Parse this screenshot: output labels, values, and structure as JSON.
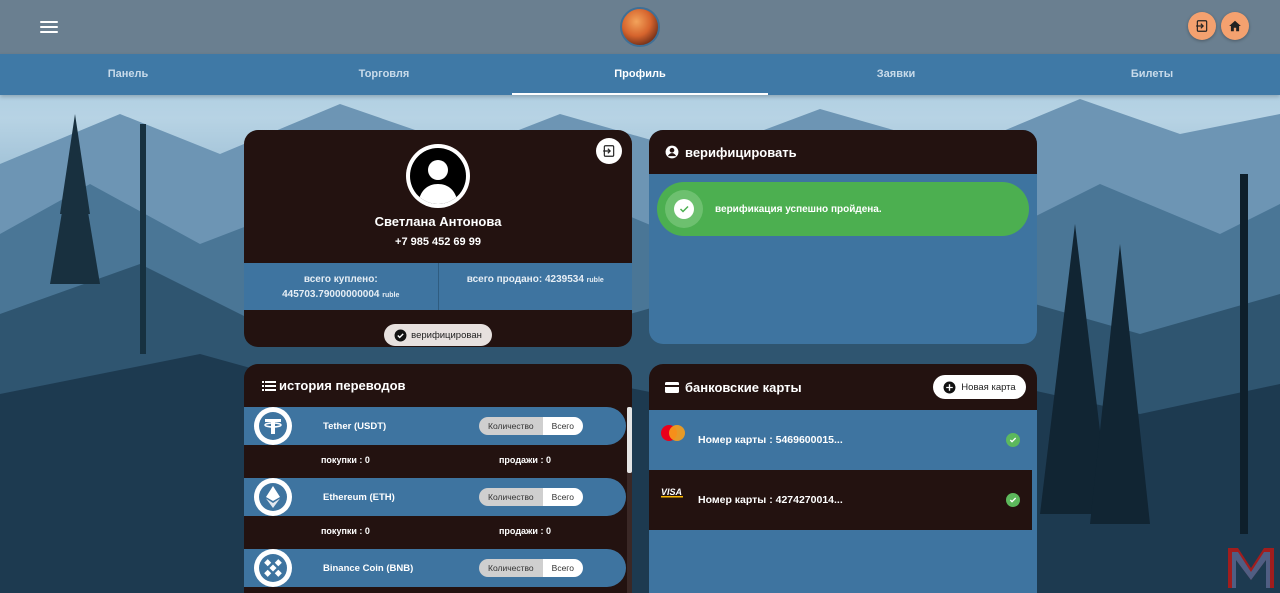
{
  "nav": {
    "tabs": [
      {
        "label": "Панель"
      },
      {
        "label": "Торговля"
      },
      {
        "label": "Профиль"
      },
      {
        "label": "Заявки"
      },
      {
        "label": "Билеты"
      }
    ],
    "active_tab": "Профиль"
  },
  "profile": {
    "name": "Светлана Антонова",
    "phone": "+7 985 452 69 99",
    "bought_label": "всего куплено:",
    "bought_value": "445703.79000000004",
    "bought_unit": "ruble",
    "sold_label": "всего продано:",
    "sold_value": "4239534",
    "sold_unit": "ruble",
    "verified_badge": "верифицирован"
  },
  "verify": {
    "title": "верифицировать",
    "message": "верификация успешно пройдена."
  },
  "history": {
    "title": "история переводов",
    "coins": [
      {
        "name": "Tether (USDT)",
        "qty_label": "Количество",
        "all_label": "Всего",
        "buys": "покупки : 0",
        "sells": "продажи : 0"
      },
      {
        "name": "Ethereum (ETH)",
        "qty_label": "Количество",
        "all_label": "Всего",
        "buys": "покупки : 0",
        "sells": "продажи : 0"
      },
      {
        "name": "Binance Coin (BNB)",
        "qty_label": "Количество",
        "all_label": "Всего"
      }
    ]
  },
  "bank": {
    "title": "банковские карты",
    "new_card_label": "Новая карта",
    "cards": [
      {
        "number": "Номер карты : 5469600015...",
        "brand": "mastercard-icon"
      },
      {
        "number": "Номер карты : 4274270014...",
        "brand": "visa-icon"
      }
    ]
  },
  "colors": {
    "dark_panel": "#231210",
    "blue_panel": "#3e74a0",
    "success": "#4caf50",
    "accent_button": "#f4a16f"
  }
}
